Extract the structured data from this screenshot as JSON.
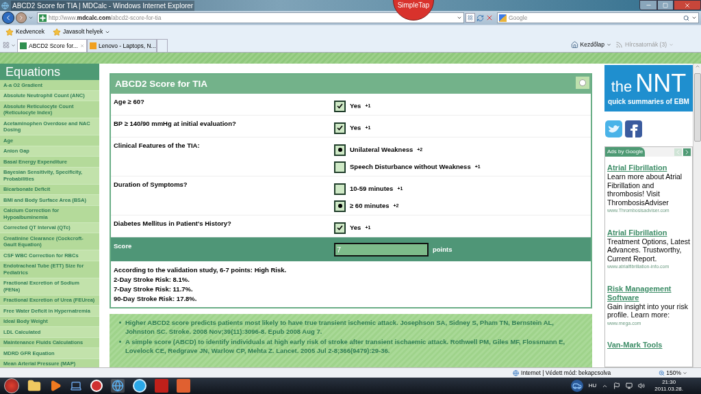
{
  "window": {
    "title": "ABCD2 Score for TIA | MDCalc - Windows Internet Explorer"
  },
  "overlay_badge": "SimpleTap",
  "address_bar": {
    "url": "http://www.**mdcalc.com**/abcd2-score-for-tia"
  },
  "search": {
    "placeholder": "Google"
  },
  "favorites_bar": [
    {
      "label": "Kedvencek",
      "menu": false
    },
    {
      "label": "Javasolt helyek",
      "menu": true
    }
  ],
  "tabs": [
    {
      "label": "ABCD2 Score for...",
      "selected": true
    },
    {
      "label": "Lenovo - Laptops, N...",
      "selected": false
    }
  ],
  "command_bar": [
    {
      "label": "Kezdőlap",
      "disabled": false
    },
    {
      "label": "Hírcsatornák (3)",
      "disabled": true
    }
  ],
  "sidebar": {
    "title": "Equations",
    "items": [
      "A-a O2 Gradient",
      "Absolute Neutrophil Count (ANC)",
      "Absolute Reticulocyte Count (Reticulocyte Index)",
      "Acetaminophen Overdose and NAC Dosing",
      "Age",
      "Anion Gap",
      "Basal Energy Expenditure",
      "Bayesian Sensitivity, Specificity, Probabilities",
      "Bicarbonate Deficit",
      "BMI and Body Surface Area (BSA)",
      "Calcium Correction for Hypoalbuminemia",
      "Corrected QT Interval (QTc)",
      "Creatinine Clearance (Cockcroft-Gault Equation)",
      "CSF WBC Correction for RBCs",
      "Endotracheal Tube (ETT) Size for Pediatrics",
      "Fractional Excretion of Sodium (FENa)",
      "Fractional Excretion of Urea (FEUrea)",
      "Free Water Deficit in Hypernatremia",
      "Ideal Body Weight",
      "LDL Calculated",
      "Maintenance Fluids Calculations",
      "MDRD GFR Equation",
      "Mean Arterial Pressure (MAP)"
    ]
  },
  "calculator": {
    "title": "ABCD2 Score for TIA",
    "questions": [
      {
        "label": "Age ≥ 60?",
        "options": [
          {
            "kind": "checkbox",
            "label": "Yes",
            "points": "+1",
            "checked": true
          }
        ]
      },
      {
        "label": "BP ≥ 140/90 mmHg at initial evaluation?",
        "options": [
          {
            "kind": "checkbox",
            "label": "Yes",
            "points": "+1",
            "checked": true
          }
        ]
      },
      {
        "label": "Clinical Features of the TIA:",
        "options": [
          {
            "kind": "radio",
            "label": "Unilateral Weakness",
            "points": "+2",
            "selected": true
          },
          {
            "kind": "radio",
            "label": "Speech Disturbance without Weakness",
            "points": "+1",
            "selected": false
          }
        ]
      },
      {
        "label": "Duration of Symptoms?",
        "options": [
          {
            "kind": "radio",
            "label": "10-59 minutes",
            "points": "+1",
            "selected": false
          },
          {
            "kind": "radio",
            "label": "≥ 60 minutes",
            "points": "+2",
            "selected": true
          }
        ]
      },
      {
        "label": "Diabetes Mellitus in Patient's History?",
        "options": [
          {
            "kind": "checkbox",
            "label": "Yes",
            "points": "+1",
            "checked": true
          }
        ]
      }
    ],
    "score": {
      "label": "Score",
      "value": "7",
      "unit": "points"
    },
    "result": [
      "According to the validation study, 6-7 points: High Risk.",
      "2-Day Stroke Risk: 8.1%.",
      "7-Day Stroke Risk: 11.7%.",
      "90-Day Stroke Risk: 17.8%."
    ]
  },
  "references": [
    "Higher ABCD2 score predicts patients most likely to have true transient ischemic attack. Josephson SA, Sidney S, Pham TN, Bernstein AL, Johnston SC. Stroke. 2008 Nov;39(11):3096-8. Epub 2008 Aug 7.",
    "A simple score (ABCD) to identify individuals at high early risk of stroke after transient ischaemic attack. Rothwell PM, Giles MF, Flossmann E, Lovelock CE, Redgrave JN, Warlow CP, Mehta Z. Lancet. 2005 Jul 2-8;366(9479):29-36."
  ],
  "nnt": {
    "small": "the",
    "big": "NNT",
    "subtitle": "quick summaries of EBM"
  },
  "ads": {
    "header": "Ads by Google",
    "items": [
      {
        "title": "Atrial Fibrillation",
        "body": "Learn more about Atrial Fibrillation and thrombosis! Visit ThrombosisAdviser",
        "url": "www.Thrombosisadviser.com"
      },
      {
        "title": "Atrial Fibrillation",
        "body": "Treatment Options, Latest Advances. Trustworthy, Current Report.",
        "url": "www.atrialfibrillation-info.com"
      },
      {
        "title": "Risk Management Software",
        "body": "Gain insight into your risk profile. Learn more:",
        "url": "www.mega.com"
      },
      {
        "title": "Van-Mark Tools"
      }
    ]
  },
  "status_bar": {
    "zone": "Internet | Védett mód: bekapcsolva",
    "zoom": "150%"
  },
  "taskbar": {
    "language": "HU",
    "time": "21:30",
    "date": "2011.03.28."
  }
}
